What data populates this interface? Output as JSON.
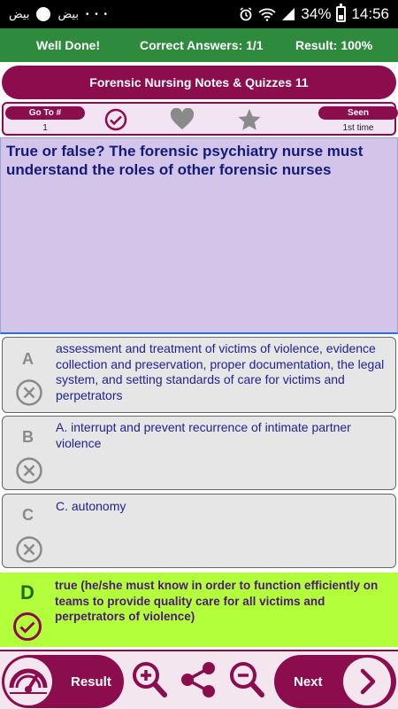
{
  "status_bar": {
    "left_labels": [
      "بيض",
      "بيض"
    ],
    "battery": "34%",
    "time": "14:56"
  },
  "result_bar": {
    "message": "Well Done!",
    "correct_answers": "Correct Answers: 1/1",
    "result": "Result: 100%"
  },
  "title": "Forensic Nursing Notes & Quizzes 11",
  "toolbar": {
    "goto_label": "Go To #",
    "goto_value": "1",
    "seen_label": "Seen",
    "seen_value": "1st time",
    "icons": [
      "check-circle-icon",
      "heart-icon",
      "star-icon"
    ]
  },
  "question": "True or false? The forensic psychiatry nurse must understand the roles of other forensic nurses",
  "answers": [
    {
      "letter": "A",
      "text": "assessment and treatment of victims of violence, evidence collection and preservation, proper documentation, the legal system, and setting standards of care for victims and perpetrators",
      "state": "wrong"
    },
    {
      "letter": "B",
      "text": "A. interrupt and prevent recurrence of intimate partner violence",
      "state": "wrong"
    },
    {
      "letter": "C",
      "text": "C. autonomy",
      "state": "wrong"
    },
    {
      "letter": "D",
      "text": "true (he/she must know in order to function efficiently on teams to provide quality care for all victims and perpetrators of violence)",
      "state": "correct"
    }
  ],
  "bottom_bar": {
    "result_label": "Result",
    "next_label": "Next"
  },
  "colors": {
    "brand": "#8c0d4d",
    "success_green": "#2e8b3e",
    "correct_bg": "#b3ff3b",
    "question_bg": "#d3c5e9"
  }
}
